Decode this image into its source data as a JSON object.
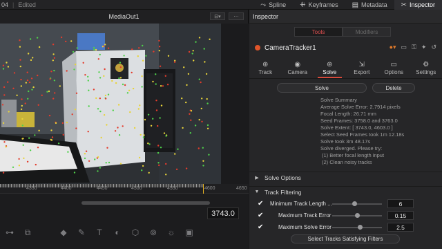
{
  "topbar": {
    "project_fragment": "04",
    "status": "Edited",
    "tabs": [
      {
        "icon": "spline-icon",
        "glyph": "⤳",
        "label": "Spline"
      },
      {
        "icon": "keyframes-icon",
        "glyph": "⁜",
        "label": "Keyframes"
      },
      {
        "icon": "metadata-icon",
        "glyph": "▤",
        "label": "Metadata"
      },
      {
        "icon": "inspector-icon",
        "glyph": "✂",
        "label": "Inspector"
      }
    ]
  },
  "viewer": {
    "title": "MediaOut1",
    "tools": [
      "●",
      "▾",
      "⌐",
      "↻",
      "⟐",
      "+",
      "⊹",
      "✎",
      "⊡",
      "⊟",
      "⌖"
    ]
  },
  "timeline": {
    "ticks": [
      "4350",
      "4400",
      "4450",
      "4500",
      "4550",
      "4600",
      "4650"
    ],
    "current_frame": "3743.0"
  },
  "inspector": {
    "title": "Inspector",
    "seg_tools": "Tools",
    "seg_modifiers": "Modifiers",
    "node_name": "CameraTracker1",
    "tabs": [
      {
        "label": "Track",
        "glyph": "⊕",
        "icon": "track-icon"
      },
      {
        "label": "Camera",
        "glyph": "◉",
        "icon": "camera-icon"
      },
      {
        "label": "Solve",
        "glyph": "⊛",
        "icon": "solve-icon"
      },
      {
        "label": "Export",
        "glyph": "⇲",
        "icon": "export-icon"
      },
      {
        "label": "Options",
        "glyph": "▭",
        "icon": "options-icon"
      },
      {
        "label": "Settings",
        "glyph": "⚙",
        "icon": "settings-icon"
      }
    ],
    "solve_button": "Solve",
    "delete_button": "Delete",
    "summary": [
      "Solve Summary",
      "Average Solve Error: 2.7914 pixels",
      "Focal Length: 26.71 mm",
      "Seed Frames: 3758.0 and 3763.0",
      "Solve Extent: [ 3743.0, 4603.0 ]",
      "Select Seed Frames took 1m 12.18s",
      "Solve took 3m 48.17s",
      "Solve diverged. Please try:",
      "(1) Better focal length input",
      "(2) Clean noisy tracks"
    ],
    "section_solve_options": "Solve Options",
    "section_track_filtering": "Track Filtering",
    "params": [
      {
        "label": "Minimum Track Length ...",
        "value": "6",
        "fraction": 0.45
      },
      {
        "label": "Maximum Track Error",
        "value": "0.15",
        "fraction": 0.5
      },
      {
        "label": "Maximum Solve Error",
        "value": "2.5",
        "fraction": 0.55
      }
    ],
    "select_tracks_button": "Select Tracks Satisfying Filters"
  }
}
